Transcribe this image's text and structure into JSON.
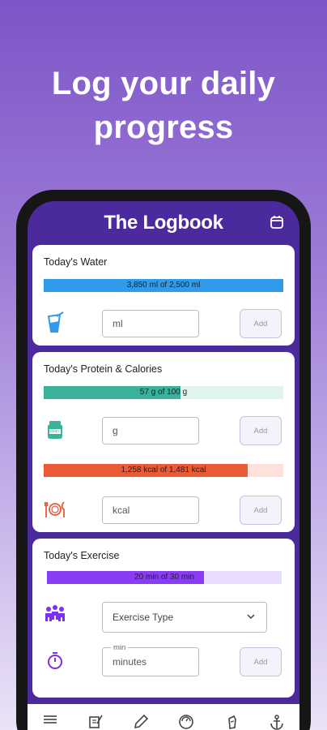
{
  "headline": {
    "line1": "Log your daily",
    "line2": "progress"
  },
  "app": {
    "title": "The Logbook"
  },
  "water": {
    "title": "Today's Water",
    "progress_label": "3,850 ml of 2,500 ml",
    "progress": 1.0,
    "input_placeholder": "ml",
    "add_label": "Add",
    "color": "#2f9bea"
  },
  "protein": {
    "title": "Today's Protein & Calories",
    "protein_label": "57 g of 100 g",
    "protein_progress": 0.57,
    "protein_placeholder": "g",
    "calories_label": "1,258 kcal of 1,481 kcal",
    "calories_progress": 0.85,
    "calories_placeholder": "kcal",
    "add_label": "Add",
    "protein_color": "#3bb09a",
    "calories_color": "#ea5a36"
  },
  "exercise": {
    "title": "Today's Exercise",
    "progress_label": "20 min of 30 min",
    "progress": 0.67,
    "type_placeholder": "Exercise Type",
    "duration_label": "min",
    "duration_placeholder": "minutes",
    "add_label": "Add",
    "color": "#8a3cf5"
  },
  "nav": {
    "items": [
      "menu-icon",
      "journal-icon",
      "pencil-icon",
      "scale-icon",
      "bottle-icon",
      "anchor-icon"
    ]
  }
}
